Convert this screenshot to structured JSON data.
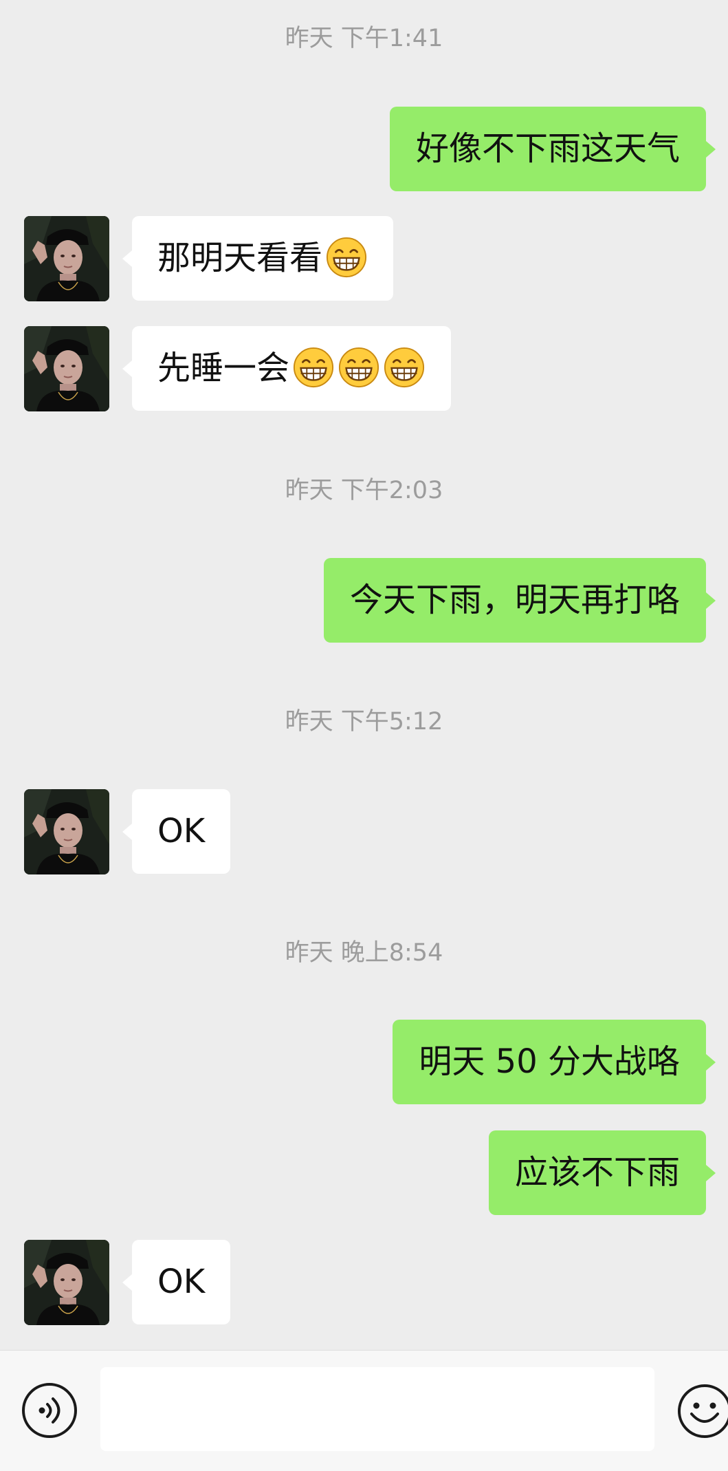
{
  "chat": {
    "timestamps": [
      "昨天 下午1:41",
      "昨天 下午2:03",
      "昨天 下午5:12",
      "昨天 晚上8:54"
    ],
    "messages": [
      {
        "text": "好像不下雨这天气",
        "emoji": []
      },
      {
        "text": "那明天看看",
        "emoji": [
          "grinning-face-emoji"
        ]
      },
      {
        "text": "先睡一会",
        "emoji": [
          "grinning-face-emoji",
          "grinning-face-emoji",
          "grinning-face-emoji"
        ]
      },
      {
        "text": "今天下雨，明天再打咯",
        "emoji": []
      },
      {
        "text": "OK",
        "emoji": []
      },
      {
        "text": "明天 50 分大战咯",
        "emoji": []
      },
      {
        "text": "应该不下雨",
        "emoji": []
      },
      {
        "text": "OK",
        "emoji": []
      }
    ]
  },
  "input_bar": {
    "voice_icon": "voice-icon",
    "input_value": "",
    "emoji_icon": "emoji-icon"
  },
  "colors": {
    "background": "#ededed",
    "outgoing_bubble": "#95ec69",
    "incoming_bubble": "#ffffff",
    "timestamp": "#9c9c9c"
  }
}
